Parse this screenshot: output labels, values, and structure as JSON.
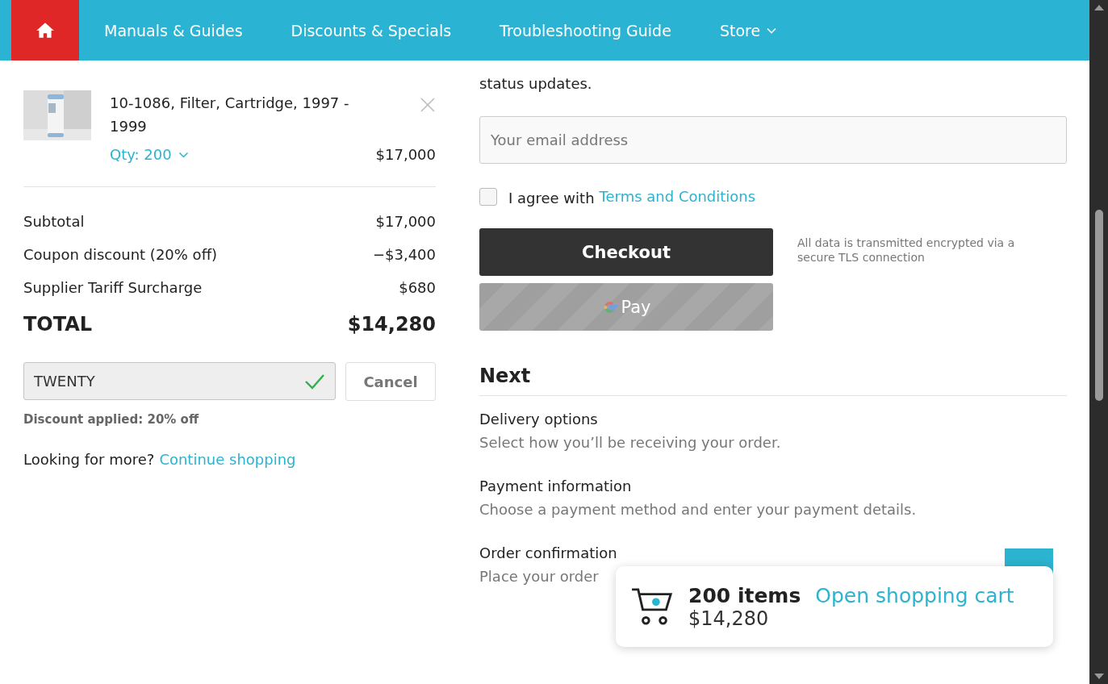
{
  "nav": {
    "home": {
      "selected": true
    },
    "items": [
      {
        "label": "Manuals & Guides",
        "kind": "link"
      },
      {
        "label": "Discounts & Specials",
        "kind": "link"
      },
      {
        "label": "Troubleshooting Guide",
        "kind": "link"
      },
      {
        "label": "Store",
        "kind": "dropdown"
      }
    ]
  },
  "cart_item": {
    "name": "10-1086, Filter, Cartridge, 1997 - 1999",
    "qty": "Qty: 200",
    "price": "$17,000"
  },
  "summary": [
    {
      "label": "Subtotal",
      "value": "$17,000"
    },
    {
      "label": "Coupon discount (20% off)",
      "value": "−$3,400"
    },
    {
      "label": "Supplier Tariff Surcharge",
      "value": "$680"
    }
  ],
  "total": {
    "label": "TOTAL",
    "value": "$14,280"
  },
  "coupon": {
    "value": "TWENTY",
    "valid": true,
    "cancel": "Cancel",
    "message": "Discount applied: 20% off"
  },
  "more": {
    "text": "Looking for more?",
    "link": "Continue shopping"
  },
  "email": {
    "intro": "status updates.",
    "placeholder": "Your email address"
  },
  "terms": {
    "checked": false,
    "text": "I agree with",
    "link": "Terms and Conditions"
  },
  "checkout": {
    "label": "Checkout"
  },
  "gpay": {
    "label": "Pay",
    "disabled": true
  },
  "security_note": "All data is transmitted encrypted via a secure TLS connection",
  "next": {
    "title": "Next",
    "steps": [
      {
        "title": "Delivery options",
        "description": "Select how you’ll be receiving your order."
      },
      {
        "title": "Payment information",
        "description": "Choose a payment method and enter your payment details."
      },
      {
        "title": "Order confirmation",
        "description": "Place your order"
      }
    ]
  },
  "mini_cart": {
    "count": "200 items",
    "total": "$14,280",
    "link": "Open shopping cart"
  }
}
